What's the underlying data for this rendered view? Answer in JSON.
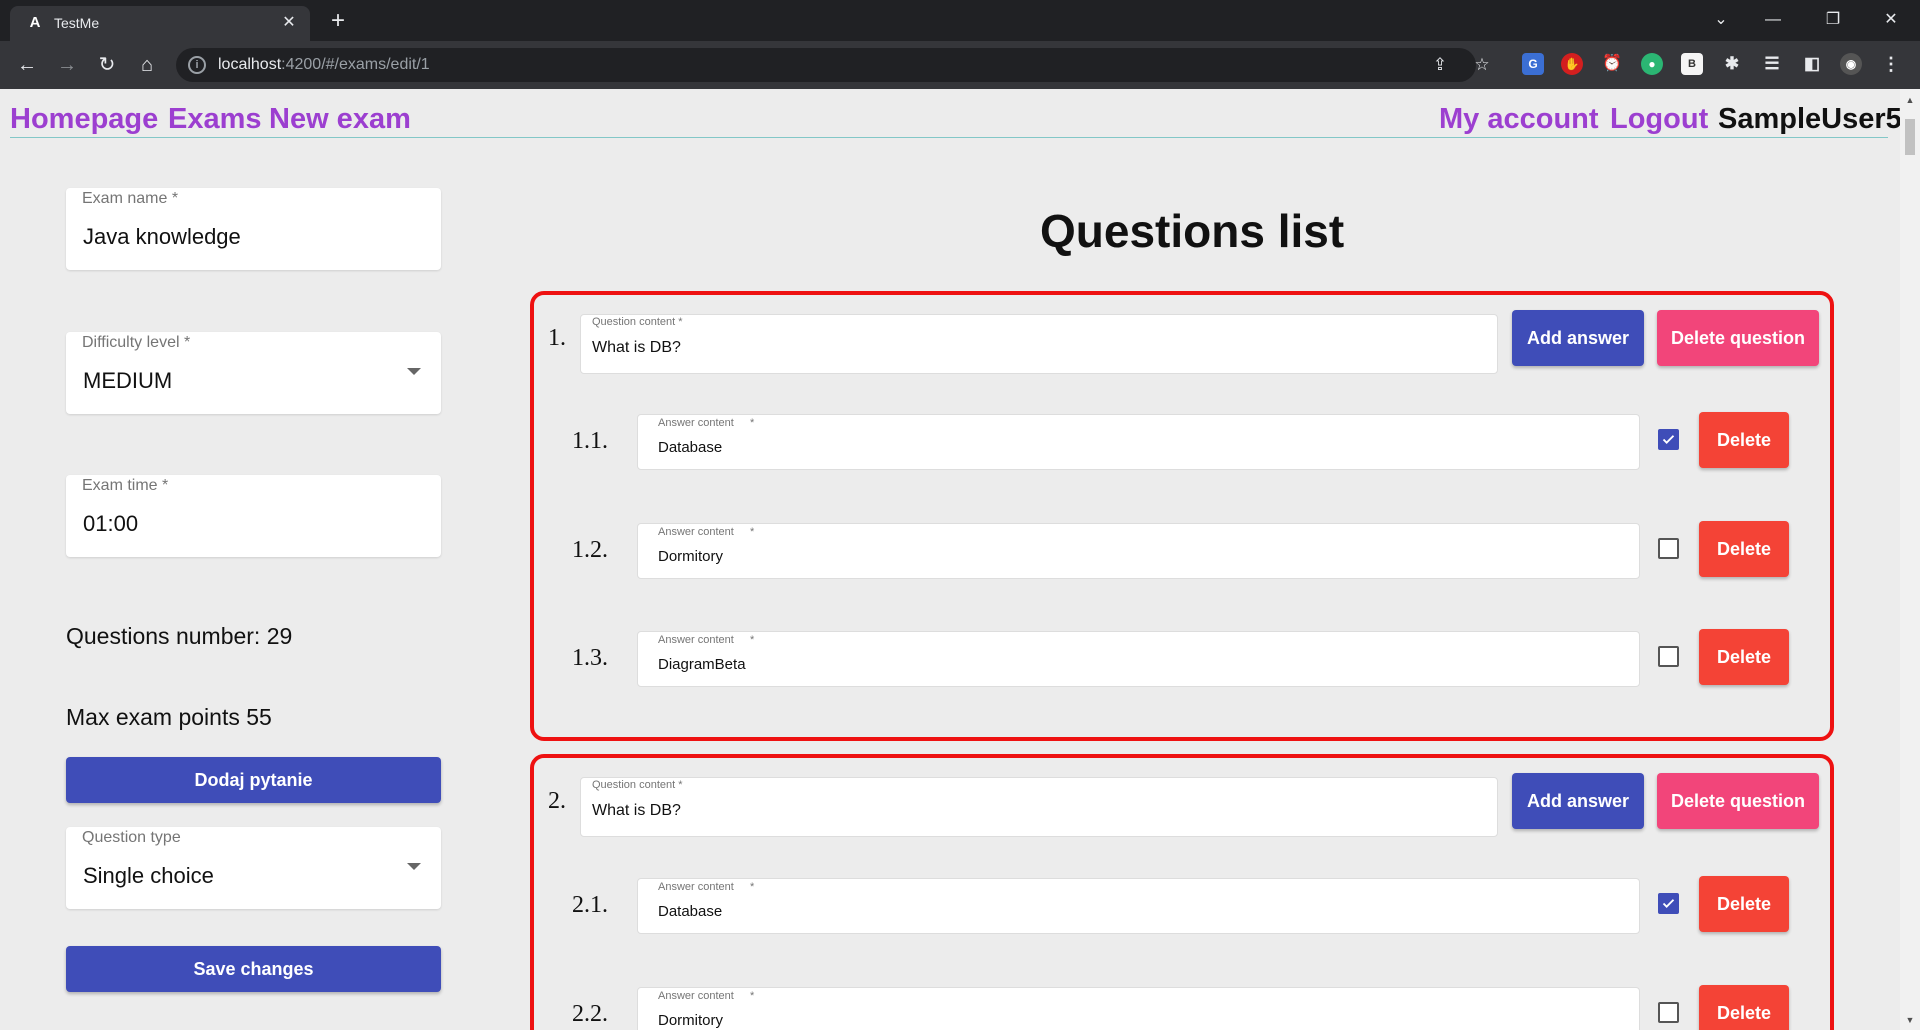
{
  "browser": {
    "tab_title": "TestMe",
    "url_host": "localhost",
    "url_rest": ":4200/#/exams/edit/1"
  },
  "nav": {
    "homepage": "Homepage",
    "exams": "Exams",
    "new_exam": "New exam",
    "my_account": "My account",
    "logout": "Logout",
    "username": "SampleUser5"
  },
  "exam_form": {
    "name_label": "Exam name *",
    "name_value": "Java knowledge",
    "difficulty_label": "Difficulty level *",
    "difficulty_value": "MEDIUM",
    "time_label": "Exam time *",
    "time_value": "01:00",
    "questions_number": "Questions number: 29",
    "max_points": "Max exam points 55",
    "add_question_label": "Dodaj pytanie",
    "question_type_label": "Question type",
    "question_type_value": "Single choice",
    "save_label": "Save changes"
  },
  "questions_title": "Questions list",
  "question_ui": {
    "content_label": "Question content *",
    "answer_label": "Answer content",
    "answer_required": "*",
    "add_answer": "Add answer",
    "delete_question": "Delete question",
    "delete_answer": "Delete"
  },
  "questions": [
    {
      "number": "1.",
      "content": "What is DB?",
      "answers": [
        {
          "number": "1.1.",
          "content": "Database",
          "checked": true
        },
        {
          "number": "1.2.",
          "content": "Dormitory",
          "checked": false
        },
        {
          "number": "1.3.",
          "content": "DiagramBeta",
          "checked": false
        }
      ]
    },
    {
      "number": "2.",
      "content": "What is DB?",
      "answers": [
        {
          "number": "2.1.",
          "content": "Database",
          "checked": true
        },
        {
          "number": "2.2.",
          "content": "Dormitory",
          "checked": false
        }
      ]
    }
  ],
  "colors": {
    "nav_link": "#9c3fd0",
    "primary": "#3f4db8",
    "danger": "#f44336",
    "accent_pink": "#f2457a",
    "question_border": "#ee1111"
  }
}
